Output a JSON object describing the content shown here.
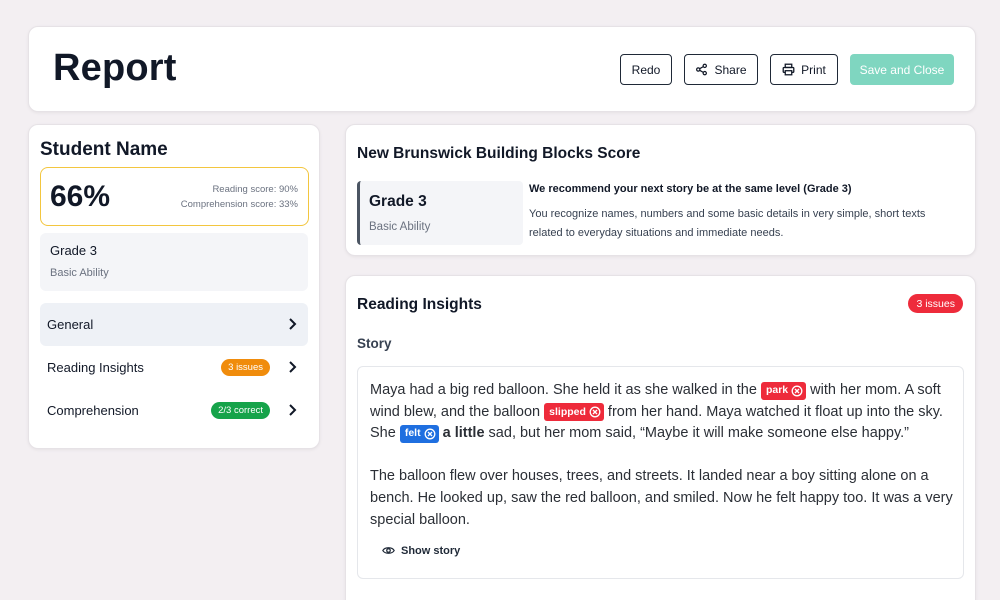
{
  "header": {
    "title": "Report",
    "buttons": {
      "redo": "Redo",
      "share": "Share",
      "print": "Print",
      "save_close": "Save and Close"
    }
  },
  "student": {
    "name": "Student Name",
    "score_percent": "66%",
    "reading_score": "Reading score: 90%",
    "comprehension_score": "Comprehension score: 33%",
    "grade": "Grade 3",
    "ability": "Basic Ability"
  },
  "nav": {
    "items": [
      {
        "label": "General",
        "badge": ""
      },
      {
        "label": "Reading Insights",
        "badge": "3 issues",
        "badge_color": "#f08c0c"
      },
      {
        "label": "Comprehension",
        "badge": "2/3 correct",
        "badge_color": "#16a34a"
      }
    ]
  },
  "score_card": {
    "title": "New Brunswick Building Blocks Score",
    "grade": "Grade 3",
    "ability": "Basic Ability",
    "recommendation_title": "We recommend your next story be at the same level (Grade 3)",
    "recommendation_text": "You recognize names, numbers and some basic details in very simple, short texts related to everyday situations and immediate needs."
  },
  "insights": {
    "title": "Reading Insights",
    "issues_badge": "3 issues",
    "story_label": "Story",
    "paragraph1": {
      "s1": "Maya had a big red balloon. She held it as she walked in the ",
      "tag1": "park",
      "s2": " with her mom. A soft wind blew, and the balloon ",
      "tag2": "slipped",
      "s3": " from her hand. Maya watched it float up into the sky. She ",
      "tag3": "felt",
      "s4": " ",
      "emph": "a little",
      "s5": " sad, but her mom said, “Maybe it will make someone else happy.”"
    },
    "paragraph2": "The balloon flew over houses, trees, and streets. It landed near a boy sitting alone on a bench. He looked up, saw the red balloon, and smiled. Now he felt happy too. It was a very special balloon.",
    "show_story": "Show story"
  },
  "colors": {
    "accent_teal": "#7fd6c0",
    "error_red": "#ee2b3b",
    "info_blue": "#1f6fe0",
    "score_border": "#f3c63f"
  },
  "icons": [
    "share-icon",
    "print-icon",
    "chevron-right-icon",
    "close-circle-icon",
    "eye-icon"
  ]
}
